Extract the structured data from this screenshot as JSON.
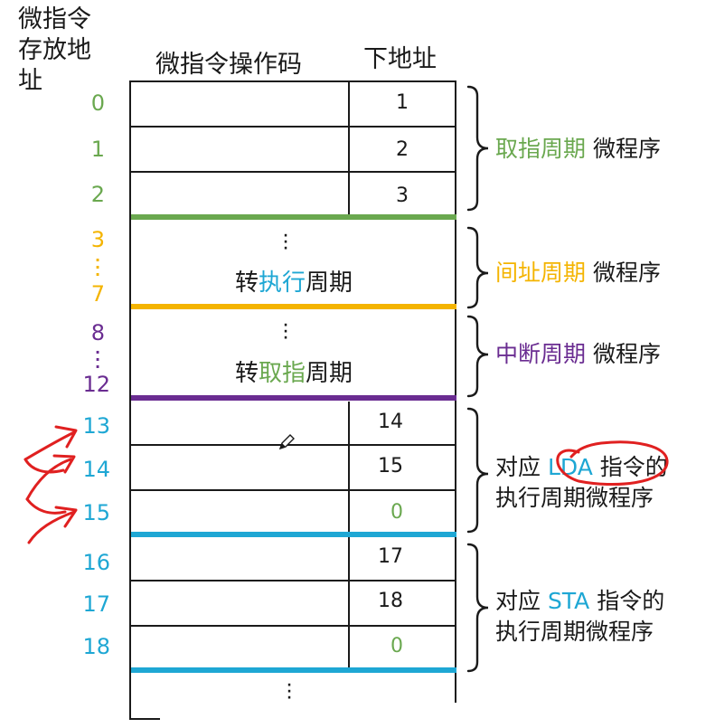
{
  "colors": {
    "green": "#6aa84f",
    "orange": "#f4b400",
    "purple": "#6a2c91",
    "blue": "#1ea7d4",
    "red": "#e02020",
    "line": "#1a1a1a"
  },
  "headers": {
    "addr_col_line1": "微指令",
    "addr_col_line2": "存放地",
    "addr_col_line3": "址",
    "opcode_col": "微指令操作码",
    "next_col": "下地址"
  },
  "addresses": {
    "a0": "0",
    "a1": "1",
    "a2": "2",
    "a3": "3",
    "a7": "7",
    "a8": "8",
    "a12": "12",
    "a13": "13",
    "a14": "14",
    "a15": "15",
    "a16": "16",
    "a17": "17",
    "a18": "18"
  },
  "next_addresses": {
    "r0": "1",
    "r1": "2",
    "r2": "3",
    "r13": "14",
    "r14": "15",
    "r15": "0",
    "r16": "17",
    "r17": "18",
    "r18": "0"
  },
  "blocks": {
    "indirect": {
      "pre": "转",
      "mid": "执行",
      "post": "周期"
    },
    "interrupt": {
      "pre": "转",
      "mid": "取指",
      "post": "周期"
    }
  },
  "labels": {
    "fetch": {
      "colored": "取指周期",
      "plain": " 微程序"
    },
    "indirect": {
      "colored": "间址周期",
      "plain": " 微程序"
    },
    "interrupt": {
      "colored": "中断周期",
      "plain": " 微程序"
    },
    "lda": {
      "pre": "对应 ",
      "keyword": "LDA",
      "post": " 指令的",
      "line2": "执行周期微程序"
    },
    "sta": {
      "pre": "对应 ",
      "keyword": "STA",
      "post": " 指令的",
      "line2": "执行周期微程序"
    }
  }
}
